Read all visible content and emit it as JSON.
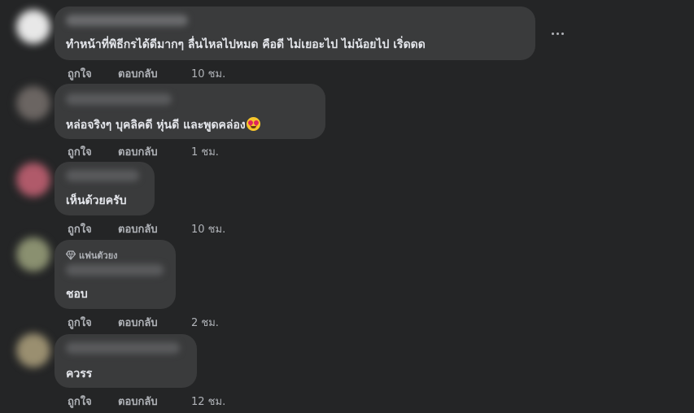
{
  "comments": [
    {
      "text": "ทำหน้าที่พิธีกรได้ดีมากๆ ลื่นไหลไปหมด คือดี ไม่เยอะไป ไม่น้อยไป เริ่ดดด",
      "like": "ถูกใจ",
      "reply": "ตอบกลับ",
      "time": "10 ชม.",
      "avatar_color": "#e8e8e8"
    },
    {
      "text": "หล่อจริงๆ บุคลิคดี หุ่นดี และพูดคล่อง",
      "emoji": "star-struck-emoji-icon",
      "like": "ถูกใจ",
      "reply": "ตอบกลับ",
      "time": "1 ชม.",
      "avatar_color": "#6b6562"
    },
    {
      "text": "เห็นด้วยครับ",
      "like": "ถูกใจ",
      "reply": "ตอบกลับ",
      "time": "10 ชม.",
      "avatar_color": "#b05a6a"
    },
    {
      "badge": "แฟนตัวยง",
      "badge_icon": "diamond-icon",
      "text": "ชอบ",
      "like": "ถูกใจ",
      "reply": "ตอบกลับ",
      "time": "2 ชม.",
      "avatar_color": "#8a9070"
    },
    {
      "text": "ควรร",
      "like": "ถูกใจ",
      "reply": "ตอบกลับ",
      "time": "12 ชม.",
      "avatar_color": "#9a8f70"
    }
  ],
  "more_menu_icon": "more-options-icon"
}
